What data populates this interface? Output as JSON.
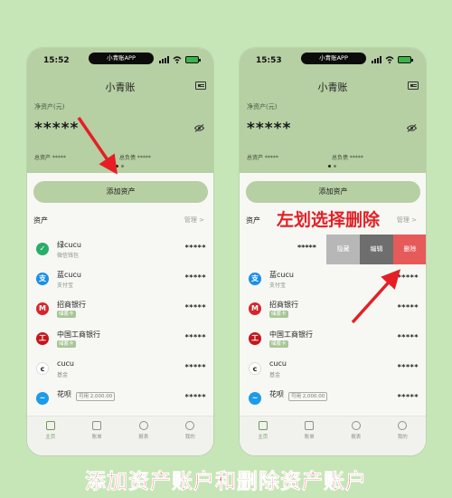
{
  "colors": {
    "background": "#c6e6b7",
    "hero": "#b6cfa3",
    "accent_red": "#e51f24",
    "delete": "#e65a5a",
    "edit": "#6e6e6e",
    "hide": "#b7b7b7"
  },
  "left": {
    "time": "15:52",
    "island_label": "小青账APP",
    "title": "小青账",
    "net_label": "净资产(元)",
    "net_value": "*****",
    "total_assets": "总资产 *****",
    "total_debt": "总负债 *****",
    "add_button": "添加资产",
    "section_title": "资产",
    "manage": "管理 >",
    "accounts": [
      {
        "name": "绿cucu",
        "sub": "微信钱包",
        "amount": "*****",
        "icon": "wechat-icon"
      },
      {
        "name": "蓝cucu",
        "sub": "支付宝",
        "amount": "*****",
        "icon": "alipay-icon"
      },
      {
        "name": "招商银行",
        "tag": "储蓄卡",
        "amount": "*****",
        "icon": "cmb-icon"
      },
      {
        "name": "中国工商银行",
        "tag": "储蓄卡",
        "amount": "*****",
        "icon": "icbc-icon"
      },
      {
        "name": "cucu",
        "sub": "基金",
        "amount": "*****",
        "icon": "fund-icon"
      },
      {
        "name": "花呗",
        "badge": "可用 2,000.00",
        "amount": "*****",
        "icon": "huabei-icon"
      }
    ],
    "tabs": [
      "主页",
      "账单",
      "报表",
      "我的"
    ]
  },
  "right": {
    "time": "15:53",
    "island_label": "小青账APP",
    "title": "小青账",
    "net_label": "净资产(元)",
    "net_value": "*****",
    "total_assets": "总资产 *****",
    "total_debt": "总负债 *****",
    "add_button": "添加资产",
    "section_title": "资产",
    "manage": "管理 >",
    "swipe_amount": "*****",
    "actions": {
      "hide": "隐藏",
      "edit": "编辑",
      "delete": "删除"
    },
    "accounts": [
      {
        "name": "蓝cucu",
        "sub": "支付宝",
        "amount": "*****",
        "icon": "alipay-icon"
      },
      {
        "name": "招商银行",
        "tag": "储蓄卡",
        "amount": "*****",
        "icon": "cmb-icon"
      },
      {
        "name": "中国工商银行",
        "tag": "储蓄卡",
        "amount": "*****",
        "icon": "icbc-icon"
      },
      {
        "name": "cucu",
        "sub": "基金",
        "amount": "*****",
        "icon": "fund-icon"
      },
      {
        "name": "花呗",
        "badge": "可用 2,000.00",
        "amount": "*****",
        "icon": "huabei-icon"
      }
    ],
    "tabs": [
      "主页",
      "账单",
      "报表",
      "我的"
    ]
  },
  "annotation": "左划选择删除",
  "caption": "添加资产账户和删除资产账户"
}
